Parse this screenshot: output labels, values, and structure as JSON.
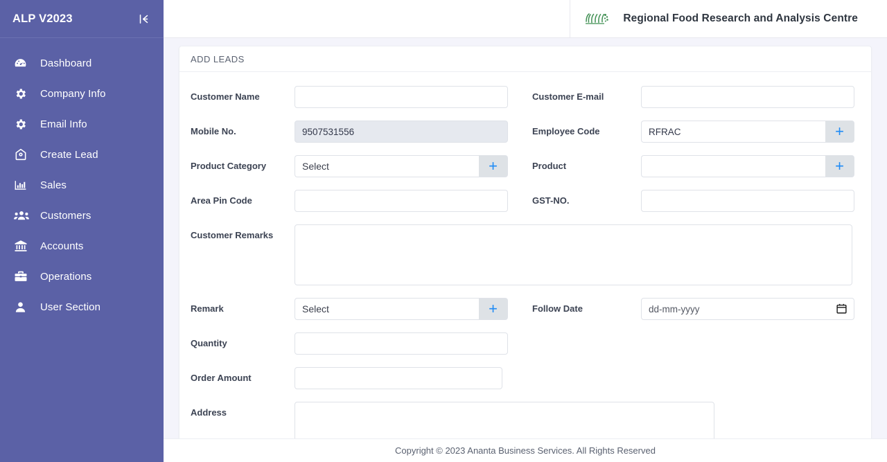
{
  "sidebar": {
    "brand": "ALP V2023",
    "collapse_icon": "collapse-left-icon",
    "items": [
      {
        "label": "Dashboard",
        "icon": "dashboard-gauge-icon"
      },
      {
        "label": "Company Info",
        "icon": "gear-icon"
      },
      {
        "label": "Email Info",
        "icon": "gear-icon"
      },
      {
        "label": "Create Lead",
        "icon": "home-icon"
      },
      {
        "label": "Sales",
        "icon": "bar-chart-icon"
      },
      {
        "label": "Customers",
        "icon": "users-group-icon"
      },
      {
        "label": "Accounts",
        "icon": "bank-icon"
      },
      {
        "label": "Operations",
        "icon": "briefcase-icon"
      },
      {
        "label": "User Section",
        "icon": "user-icon"
      }
    ]
  },
  "header": {
    "logo_icon": "rfrac-logo-icon",
    "org_title": "Regional Food Research and Analysis Centre"
  },
  "card": {
    "title": "ADD LEADS"
  },
  "form": {
    "customer_name": {
      "label": "Customer Name",
      "value": "",
      "placeholder": ""
    },
    "customer_email": {
      "label": "Customer E-mail",
      "value": "",
      "placeholder": ""
    },
    "mobile_no": {
      "label": "Mobile No.",
      "value": "9507531556",
      "placeholder": "",
      "disabled": true
    },
    "employee_code": {
      "label": "Employee Code",
      "value": "RFRAC",
      "placeholder": "",
      "addon": "plus-icon"
    },
    "product_category": {
      "label": "Product Category",
      "value": "Select",
      "placeholder": "Select",
      "addon": "plus-icon"
    },
    "product": {
      "label": "Product",
      "value": "",
      "placeholder": "",
      "addon": "plus-icon"
    },
    "area_pin_code": {
      "label": "Area Pin Code",
      "value": "",
      "placeholder": ""
    },
    "gst_no": {
      "label": "GST-NO.",
      "value": "",
      "placeholder": ""
    },
    "customer_remarks": {
      "label": "Customer Remarks",
      "value": "",
      "placeholder": ""
    },
    "remark": {
      "label": "Remark",
      "value": "Select",
      "placeholder": "Select",
      "addon": "plus-icon"
    },
    "follow_date": {
      "label": "Follow Date",
      "value": "",
      "placeholder": "dd-mm-yyyy",
      "icon": "calendar-icon"
    },
    "quantity": {
      "label": "Quantity",
      "value": "",
      "placeholder": ""
    },
    "order_amount": {
      "label": "Order Amount",
      "value": "",
      "placeholder": ""
    },
    "address": {
      "label": "Address",
      "value": "",
      "placeholder": ""
    }
  },
  "footer": {
    "text": "Copyright © 2023 Ananta Business Services. All Rights Reserved"
  },
  "colors": {
    "sidebar": "#5b61a6",
    "page_bg": "#f4f4fb",
    "accent_plus": "#1f8bf5",
    "addon_bg": "#dee2e6",
    "disabled_bg": "#e6e9ef",
    "logo_green": "#3f8f52"
  }
}
